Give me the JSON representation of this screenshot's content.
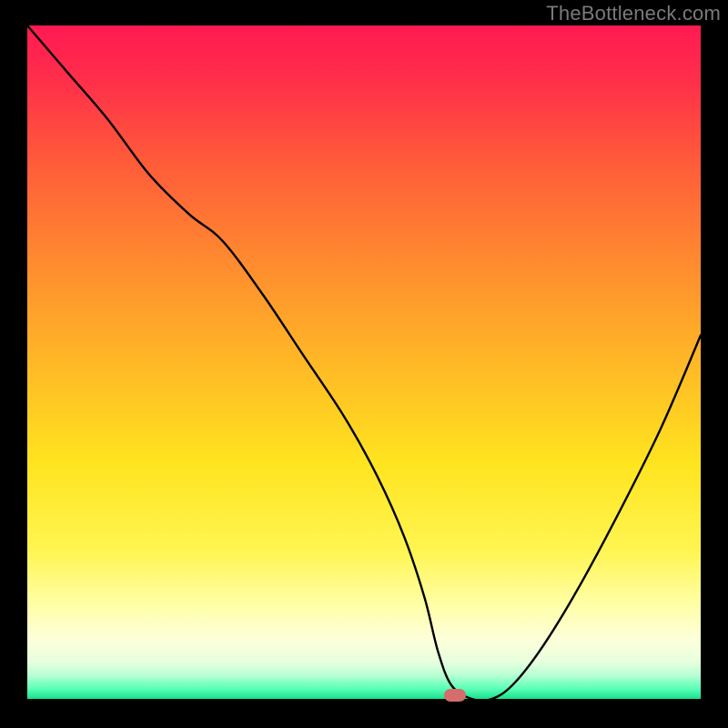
{
  "watermark": "TheBottleneck.com",
  "chart_data": {
    "type": "line",
    "title": "",
    "xlabel": "",
    "ylabel": "",
    "xlim": [
      0,
      100
    ],
    "ylim": [
      0,
      100
    ],
    "grid": false,
    "legend": false,
    "gradient_stops": [
      {
        "offset": 0,
        "color": "#ff1a52"
      },
      {
        "offset": 0.08,
        "color": "#ff2e4a"
      },
      {
        "offset": 0.2,
        "color": "#ff5a3a"
      },
      {
        "offset": 0.35,
        "color": "#ff8a2f"
      },
      {
        "offset": 0.5,
        "color": "#ffb826"
      },
      {
        "offset": 0.65,
        "color": "#ffe41f"
      },
      {
        "offset": 0.78,
        "color": "#fff552"
      },
      {
        "offset": 0.86,
        "color": "#ffffa6"
      },
      {
        "offset": 0.91,
        "color": "#fdffd8"
      },
      {
        "offset": 0.945,
        "color": "#e8ffde"
      },
      {
        "offset": 0.965,
        "color": "#b7ffd4"
      },
      {
        "offset": 0.985,
        "color": "#59ffb6"
      },
      {
        "offset": 1.0,
        "color": "#18e08c"
      }
    ],
    "series": [
      {
        "name": "bottleneck-curve",
        "color": "#000000",
        "x": [
          0,
          6,
          12,
          18,
          24,
          29,
          35,
          41,
          47,
          52,
          56,
          59,
          61,
          63,
          66,
          69,
          72,
          76,
          81,
          87,
          94,
          100
        ],
        "y": [
          100,
          93,
          86,
          78,
          72,
          68,
          60,
          51,
          42,
          33,
          24,
          15,
          7,
          2,
          0,
          0,
          2,
          7,
          15,
          26,
          40,
          54
        ]
      }
    ],
    "marker": {
      "x": 63.5,
      "y": 0.5,
      "color": "#d66d6d"
    }
  }
}
